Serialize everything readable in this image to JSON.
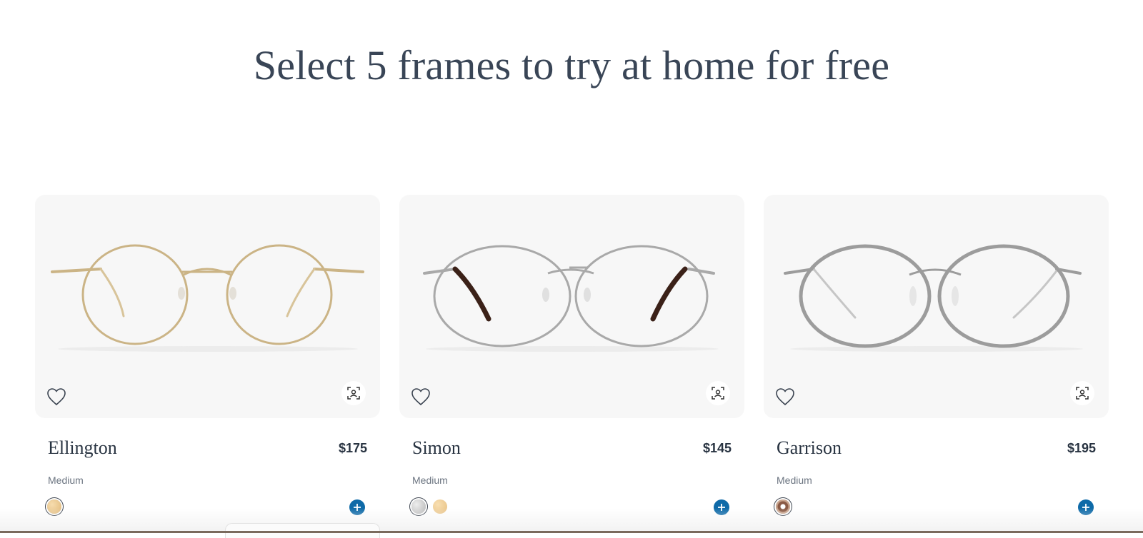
{
  "page": {
    "headline": "Select 5 frames to try at home for free"
  },
  "colors": {
    "accent": "#0e6aa8",
    "card_bg": "#f7f7f7",
    "text": "#283341"
  },
  "products": [
    {
      "name": "Ellington",
      "price": "$175",
      "size": "Medium",
      "frame_color": "#cbb486",
      "temple_tip_color": "#cbb486",
      "swatches": [
        {
          "color": "#e8c48f",
          "selected": true
        }
      ],
      "icons": {
        "favorite": "heart-icon",
        "try_on": "face-scan-icon",
        "add": "plus-icon"
      }
    },
    {
      "name": "Simon",
      "price": "$145",
      "size": "Medium",
      "frame_color": "#a9a9a9",
      "temple_tip_color": "#3b2118",
      "swatches": [
        {
          "color": "#c8c8c8",
          "selected": true
        },
        {
          "color": "#ecc98f",
          "selected": false
        }
      ],
      "icons": {
        "favorite": "heart-icon",
        "try_on": "face-scan-icon",
        "add": "plus-icon"
      }
    },
    {
      "name": "Garrison",
      "price": "$195",
      "size": "Medium",
      "frame_color": "#9c9c9c",
      "temple_tip_color": "#bdbdbd",
      "swatches": [
        {
          "color": "#8a5a45",
          "selected": true
        }
      ],
      "icons": {
        "favorite": "heart-icon",
        "try_on": "face-scan-icon",
        "add": "plus-icon"
      }
    }
  ]
}
